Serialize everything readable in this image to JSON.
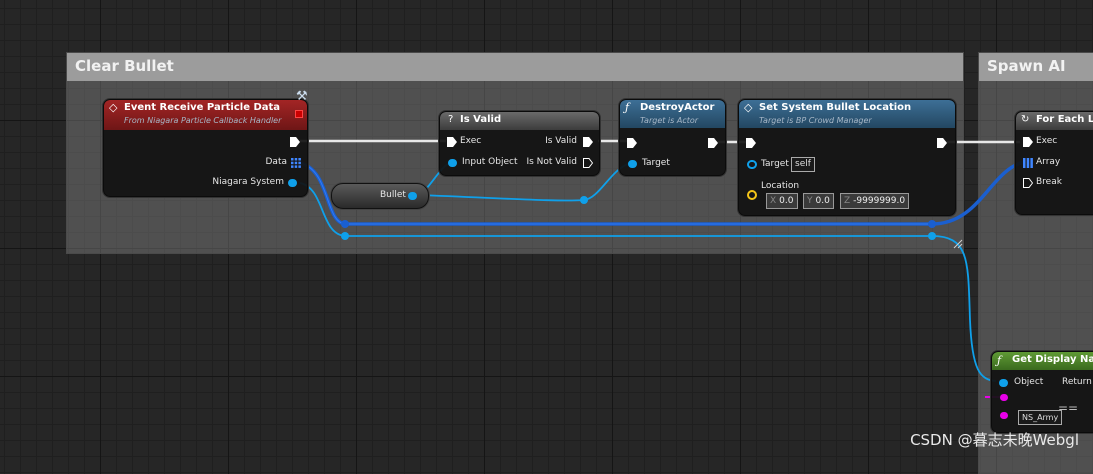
{
  "comments": {
    "clear_bullet": "Clear Bullet",
    "spawn_ai": "Spawn AI"
  },
  "nodes": {
    "event_receive": {
      "title": "Event Receive Particle Data",
      "subtitle": "From Niagara Particle Callback Handler",
      "pins": {
        "data": "Data",
        "niagara_system": "Niagara System"
      }
    },
    "bullet_var": {
      "label": "Bullet"
    },
    "is_valid": {
      "title": "Is Valid",
      "pins": {
        "exec": "Exec",
        "input_object": "Input Object",
        "is_valid": "Is Valid",
        "is_not_valid": "Is Not Valid"
      }
    },
    "destroy_actor": {
      "title": "DestroyActor",
      "subtitle": "Target is Actor",
      "pins": {
        "target": "Target"
      }
    },
    "set_location": {
      "title": "Set System Bullet Location",
      "subtitle": "Target is BP Crowd Manager",
      "pins": {
        "target": "Target",
        "target_value": "self",
        "location": "Location"
      },
      "location": {
        "x_label": "X",
        "x": "0.0",
        "y_label": "Y",
        "y": "0.0",
        "z_label": "Z",
        "z": "-9999999.0"
      }
    },
    "for_each": {
      "title": "For Each Lo",
      "pins": {
        "exec": "Exec",
        "array": "Array",
        "break": "Break"
      }
    },
    "get_display_name": {
      "title": "Get Display Name",
      "pins": {
        "object": "Object",
        "return": "Return V"
      },
      "ns_value": "NS_Army"
    }
  },
  "watermark": "CSDN @暮志未晚Webgl",
  "colors": {
    "event_header": "#8c1f1f",
    "function_header": "#2e5a7c",
    "pure_header": "#4a8a2a",
    "object_pin": "#0fa0ea",
    "string_pin": "#e800e8"
  }
}
